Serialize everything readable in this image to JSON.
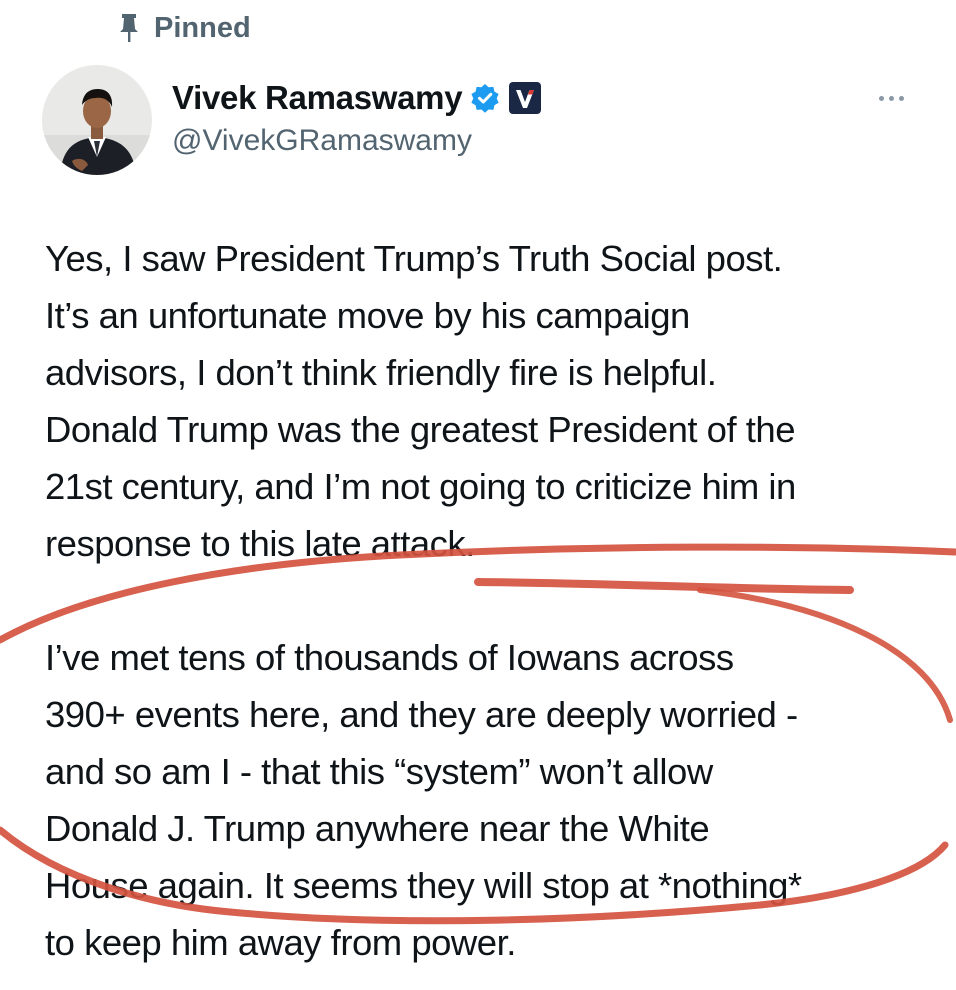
{
  "pinned": {
    "label": "Pinned",
    "icon": "pin-icon"
  },
  "author": {
    "name": "Vivek Ramaswamy",
    "handle": "@VivekGRamaswamy",
    "verified_icon": "verified-badge-icon",
    "affiliate_icon": "affiliate-v-logo-icon",
    "avatar": "avatar"
  },
  "post": {
    "paragraph_1": "Yes, I saw President Trump’s Truth Social post.\nIt’s an unfortunate move by his campaign\nadvisors, I don’t think friendly fire is helpful.\nDonald Trump was the greatest President of the\n21st century, and I’m not going to criticize him in\nresponse to this late attack.",
    "paragraph_2": "I’ve met tens of thousands of Iowans across\n390+ events here, and they are deeply worried -\nand so am I - that this “system” won’t allow\nDonald J. Trump anywhere near the White\nHouse again. It seems they will stop at *nothing*\nto keep him away from power."
  },
  "colors": {
    "text": "#0f1419",
    "secondary": "#536471",
    "verified": "#1d9bf0",
    "affiliate_bg": "#1a2745",
    "annotation": "#d4533f"
  }
}
